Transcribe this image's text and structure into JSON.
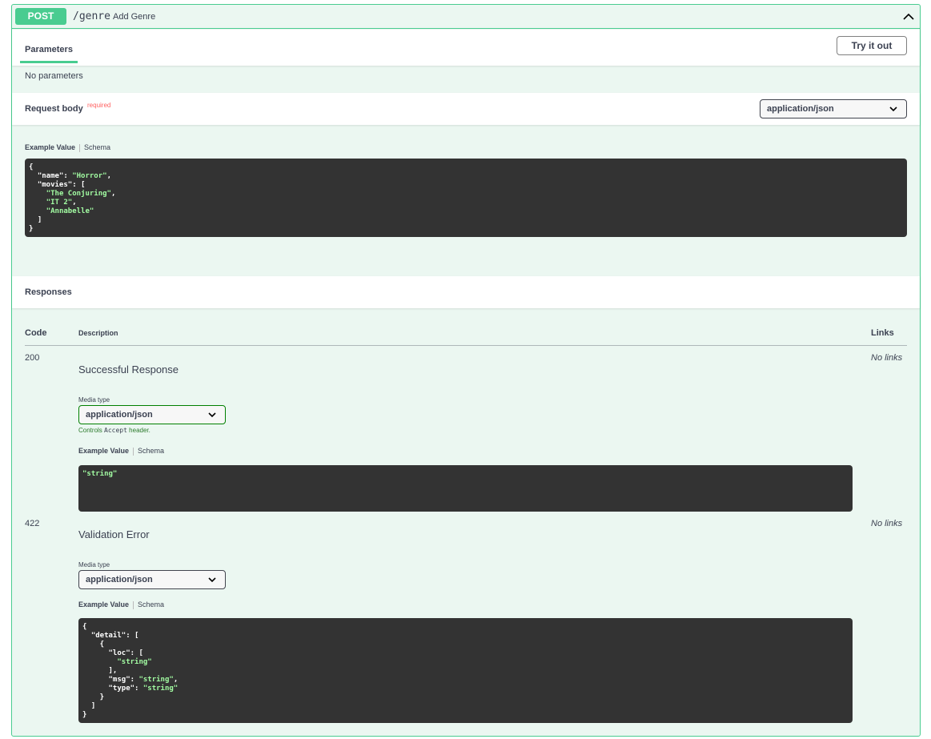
{
  "operation": {
    "method": "POST",
    "path": "/genre",
    "summary": "Add Genre"
  },
  "parameters": {
    "tab_label": "Parameters",
    "try_button": "Try it out",
    "empty_text": "No parameters"
  },
  "request_body": {
    "title": "Request body",
    "required_label": "required",
    "content_type": "application/json",
    "example_tab": "Example Value",
    "schema_tab": "Schema"
  },
  "responses": {
    "title": "Responses",
    "columns": {
      "code": "Code",
      "description": "Description",
      "links": "Links"
    },
    "items": [
      {
        "code": "200",
        "description": "Successful Response",
        "media_type_label": "Media type",
        "media_type": "application/json",
        "controls_prefix": "Controls",
        "controls_code": "Accept",
        "controls_suffix": "header.",
        "example_tab": "Example Value",
        "schema_tab": "Schema",
        "links": "No links"
      },
      {
        "code": "422",
        "description": "Validation Error",
        "media_type_label": "Media type",
        "media_type": "application/json",
        "example_tab": "Example Value",
        "schema_tab": "Schema",
        "links": "No links"
      }
    ]
  },
  "colors": {
    "post_green": "#49cc90",
    "block_bg": "#ebf7f1",
    "code_bg": "#333333",
    "string_green": "#a2fca2",
    "required_red": "#ff6060"
  }
}
